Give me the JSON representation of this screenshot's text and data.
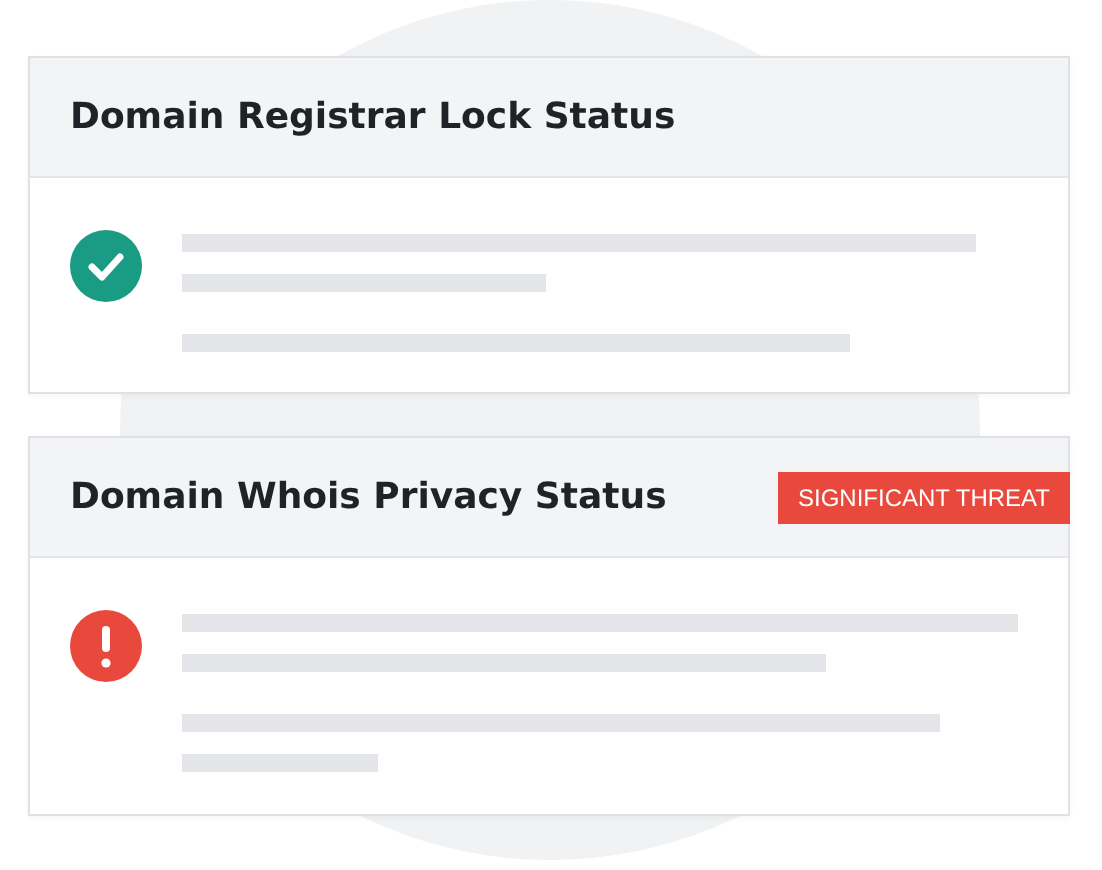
{
  "cards": [
    {
      "title": "Domain Registrar Lock Status",
      "kind": "ok"
    },
    {
      "title": "Domain Whois Privacy Status",
      "kind": "threat",
      "badge": "SIGNIFICANT THREAT"
    }
  ]
}
